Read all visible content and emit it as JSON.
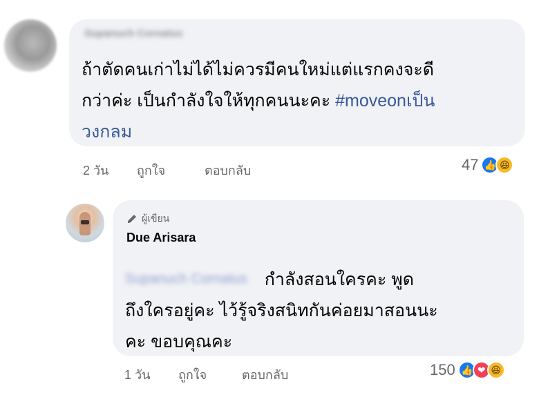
{
  "comments": [
    {
      "name_blurred": "Supanuch Cornatus",
      "text_lines": [
        "ถ้าตัดคนเก่าไม่ได้ไม่ควรมีคนใหม่แต่แรกคงจะดี",
        "กว่าค่ะ เป็นกำลังใจให้ทุกคนนะคะ "
      ],
      "hashtag_part1": "#moveonเป็น",
      "hashtag_part2": "วงกลม",
      "time": "2 วัน",
      "like_label": "ถูกใจ",
      "reply_label": "ตอบกลับ",
      "reaction_count": "47",
      "reaction_icons": [
        "like-icon",
        "haha-icon"
      ]
    },
    {
      "author_badge": "ผู้เขียน",
      "name": "Due Arisara",
      "mention_blurred": "Supanuch Cornatus",
      "text_lines": [
        "กำลังสอนใครคะ พูด",
        "ถึงใครอยู่คะ ไว้รู้จริงสนิทกันค่อยมาสอนนะ",
        "คะ ขอบคุณคะ"
      ],
      "time": "1 วัน",
      "like_label": "ถูกใจ",
      "reply_label": "ตอบกลับ",
      "reaction_count": "150",
      "reaction_icons": [
        "like-icon",
        "love-icon",
        "haha-icon"
      ]
    }
  ],
  "colors": {
    "bubble": "#f0f2f5",
    "hashtag": "#385898",
    "meta": "#65676b",
    "like": "#1877f2",
    "love": "#f33e58",
    "haha": "#f7b928"
  }
}
